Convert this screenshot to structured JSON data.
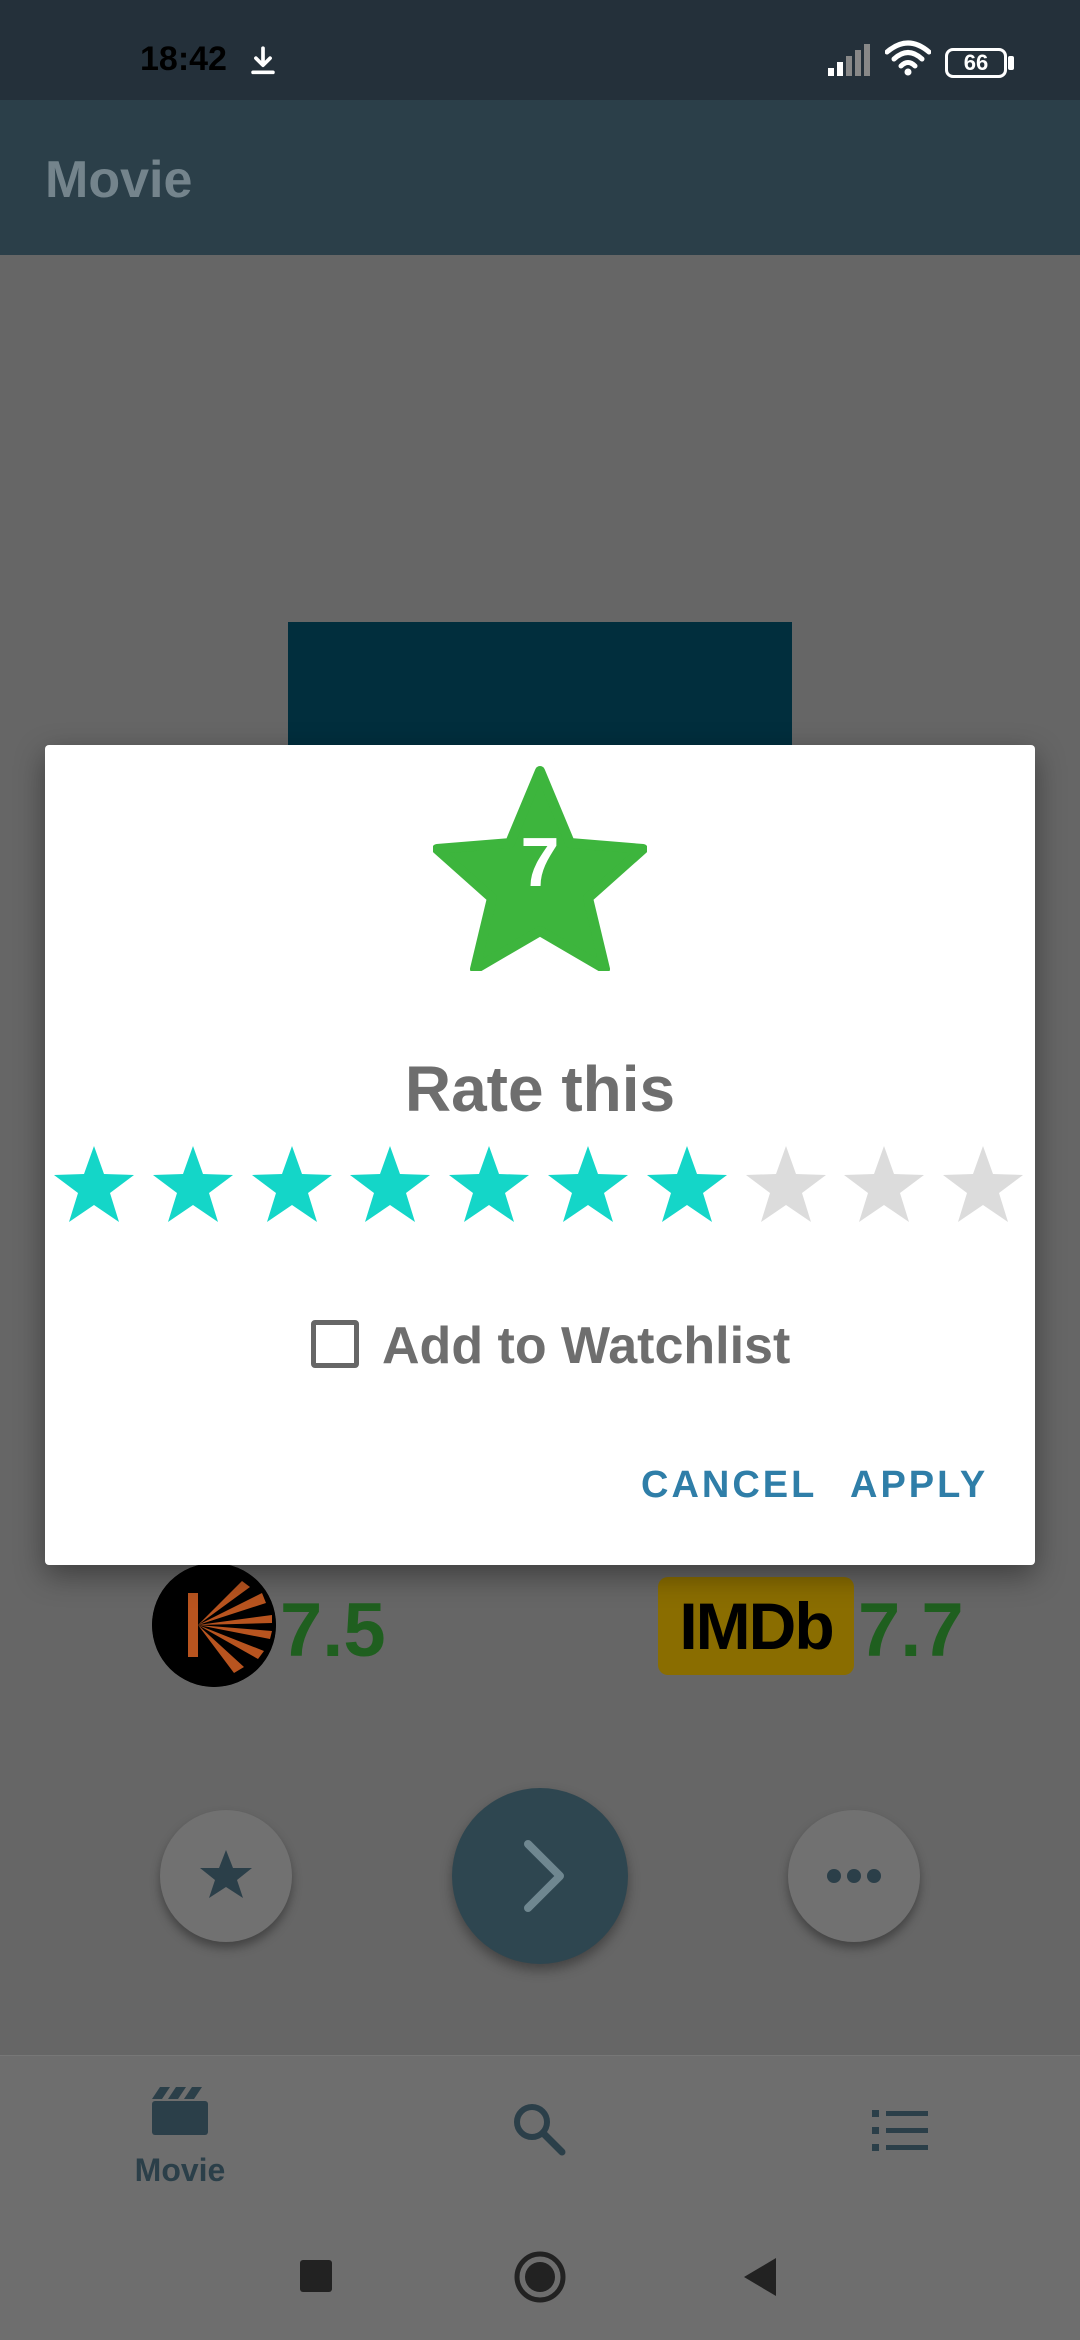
{
  "status_bar": {
    "time": "18:42",
    "battery": "66"
  },
  "app_bar": {
    "title": "Movie"
  },
  "ratings": {
    "kinopoisk_score": "7.5",
    "imdb_logo_text": "IMDb",
    "imdb_score": "7.7"
  },
  "bottom_nav": {
    "movie_label": "Movie"
  },
  "dialog": {
    "selected_rating": "7",
    "title": "Rate this",
    "stars_total": 10,
    "stars_filled": 7,
    "checkbox_label": "Add to Watchlist",
    "cancel_label": "CANCEL",
    "apply_label": "APPLY"
  },
  "colors": {
    "filled_star": "#14d6c8",
    "empty_star": "#dcdcdc",
    "big_star": "#3db53d",
    "button_text": "#2f7ea8"
  }
}
